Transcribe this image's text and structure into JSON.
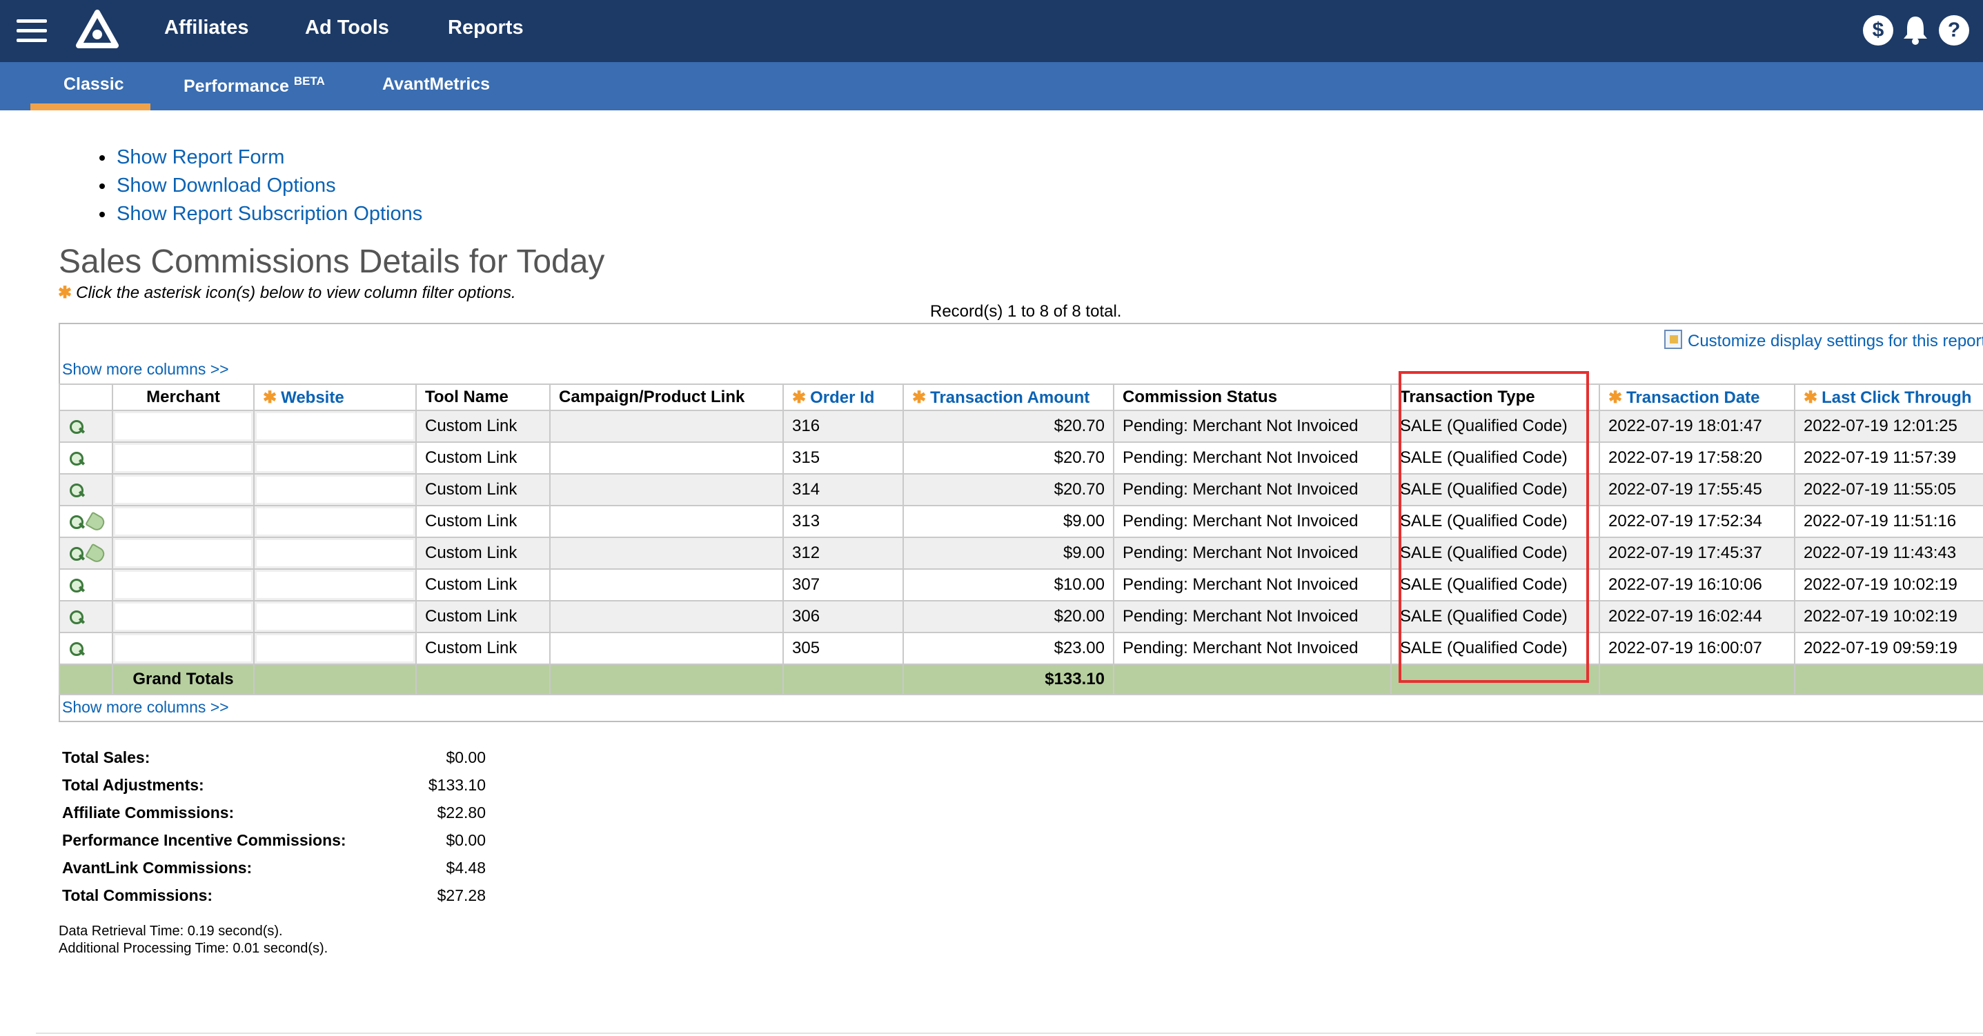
{
  "topnav": {
    "items": [
      "Affiliates",
      "Ad Tools",
      "Reports"
    ],
    "dollar_icon": "$",
    "help_icon": "?"
  },
  "subnav": {
    "tabs": [
      {
        "label": "Classic",
        "active": true
      },
      {
        "label": "Performance",
        "sup": "BETA"
      },
      {
        "label": "AvantMetrics"
      }
    ],
    "active_color": "#f0a24a"
  },
  "links": [
    "Show Report Form",
    "Show Download Options",
    "Show Report Subscription Options"
  ],
  "title": "Sales Commissions Details for Today",
  "hint": "Click the asterisk icon(s) below to view column filter options.",
  "records_text": "Record(s) 1 to 8 of 8 total.",
  "customize_text": "Customize display settings for this report",
  "show_more_columns": "Show more columns >>",
  "table": {
    "columns": [
      {
        "label": "",
        "filter": false
      },
      {
        "label": "Merchant",
        "filter": false
      },
      {
        "label": "Website",
        "filter": true
      },
      {
        "label": "Tool Name",
        "filter": false
      },
      {
        "label": "Campaign/Product Link",
        "filter": false
      },
      {
        "label": "Order Id",
        "filter": true
      },
      {
        "label": "Transaction Amount",
        "filter": true
      },
      {
        "label": "Commission Status",
        "filter": false
      },
      {
        "label": "Transaction Type",
        "filter": false
      },
      {
        "label": "Transaction Date",
        "filter": true
      },
      {
        "label": "Last Click Through",
        "filter": true
      }
    ],
    "rows": [
      {
        "icons": [
          "zoom-icon"
        ],
        "tool": "Custom Link",
        "order_id": "316",
        "amount": "$20.70",
        "status": "Pending: Merchant Not Invoiced",
        "type": "SALE (Qualified Code)",
        "date": "2022-07-19 18:01:47",
        "last_click": "2022-07-19 12:01:25"
      },
      {
        "icons": [
          "zoom-icon"
        ],
        "tool": "Custom Link",
        "order_id": "315",
        "amount": "$20.70",
        "status": "Pending: Merchant Not Invoiced",
        "type": "SALE (Qualified Code)",
        "date": "2022-07-19 17:58:20",
        "last_click": "2022-07-19 11:57:39"
      },
      {
        "icons": [
          "zoom-icon"
        ],
        "tool": "Custom Link",
        "order_id": "314",
        "amount": "$20.70",
        "status": "Pending: Merchant Not Invoiced",
        "type": "SALE (Qualified Code)",
        "date": "2022-07-19 17:55:45",
        "last_click": "2022-07-19 11:55:05"
      },
      {
        "icons": [
          "zoom-icon",
          "tag-icon"
        ],
        "tool": "Custom Link",
        "order_id": "313",
        "amount": "$9.00",
        "status": "Pending: Merchant Not Invoiced",
        "type": "SALE (Qualified Code)",
        "date": "2022-07-19 17:52:34",
        "last_click": "2022-07-19 11:51:16"
      },
      {
        "icons": [
          "zoom-icon",
          "tag-icon"
        ],
        "tool": "Custom Link",
        "order_id": "312",
        "amount": "$9.00",
        "status": "Pending: Merchant Not Invoiced",
        "type": "SALE (Qualified Code)",
        "date": "2022-07-19 17:45:37",
        "last_click": "2022-07-19 11:43:43"
      },
      {
        "icons": [
          "zoom-icon"
        ],
        "tool": "Custom Link",
        "order_id": "307",
        "amount": "$10.00",
        "status": "Pending: Merchant Not Invoiced",
        "type": "SALE (Qualified Code)",
        "date": "2022-07-19 16:10:06",
        "last_click": "2022-07-19 10:02:19"
      },
      {
        "icons": [
          "zoom-icon"
        ],
        "tool": "Custom Link",
        "order_id": "306",
        "amount": "$20.00",
        "status": "Pending: Merchant Not Invoiced",
        "type": "SALE (Qualified Code)",
        "date": "2022-07-19 16:02:44",
        "last_click": "2022-07-19 10:02:19"
      },
      {
        "icons": [
          "zoom-icon"
        ],
        "tool": "Custom Link",
        "order_id": "305",
        "amount": "$23.00",
        "status": "Pending: Merchant Not Invoiced",
        "type": "SALE (Qualified Code)",
        "date": "2022-07-19 16:00:07",
        "last_click": "2022-07-19 09:59:19"
      }
    ],
    "totals": {
      "label": "Grand Totals",
      "amount": "$133.10"
    }
  },
  "summary": [
    {
      "label": "Total Sales:",
      "value": "$0.00"
    },
    {
      "label": "Total Adjustments:",
      "value": "$133.10"
    },
    {
      "label": "Affiliate Commissions:",
      "value": "$22.80"
    },
    {
      "label": "Performance Incentive Commissions:",
      "value": "$0.00"
    },
    {
      "label": "AvantLink Commissions:",
      "value": "$4.48"
    },
    {
      "label": "Total Commissions:",
      "value": "$27.28"
    }
  ],
  "timing": [
    "Data Retrieval Time: 0.19 second(s).",
    "Additional Processing Time: 0.01 second(s)."
  ],
  "colors": {
    "nav": "#1d3a66",
    "subnav": "#3a6db1",
    "link": "#0a62b4",
    "totals_row": "#b7cf9f",
    "highlight": "#e53030"
  }
}
